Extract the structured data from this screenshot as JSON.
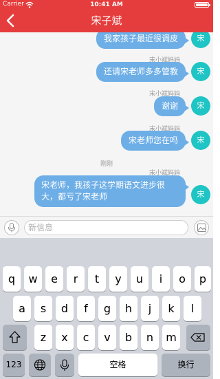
{
  "status_bar": {
    "carrier": "Carrier",
    "time": "10:41 AM"
  },
  "nav": {
    "title": "宋子斌"
  },
  "chat": {
    "timestamp": "刚刚",
    "messages": [
      {
        "sender": "",
        "text": "我家孩子最近很调皮",
        "avatar": "宋"
      },
      {
        "sender": "宋小斌妈妈",
        "text": "还请宋老师多多管教",
        "avatar": "宋"
      },
      {
        "sender": "宋小斌妈妈",
        "text": "谢谢",
        "avatar": "宋"
      },
      {
        "sender": "宋小斌妈妈",
        "text": "宋老师您在吗",
        "avatar": "宋"
      },
      {
        "sender": "宋小斌妈妈",
        "text": "宋老师，我孩子这学期语文进步很大，都亏了宋老师",
        "avatar": "宋"
      }
    ]
  },
  "input_bar": {
    "placeholder": "新信息"
  },
  "keyboard": {
    "row1": [
      "q",
      "w",
      "e",
      "r",
      "t",
      "y",
      "u",
      "i",
      "o",
      "p"
    ],
    "row2": [
      "a",
      "s",
      "d",
      "f",
      "g",
      "h",
      "j",
      "k",
      "l"
    ],
    "row3": [
      "z",
      "x",
      "c",
      "v",
      "b",
      "n",
      "m"
    ],
    "numbers_label": "123",
    "space_label": "空格",
    "return_label": "换行"
  },
  "colors": {
    "header": "#e53d3d",
    "bubble": "#6daee6",
    "avatar": "#1fc4c4"
  }
}
